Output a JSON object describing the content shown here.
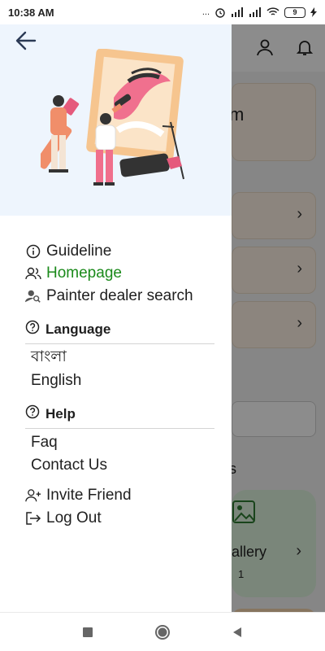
{
  "status_bar": {
    "time": "10:38 AM",
    "dots": "...",
    "battery": "9"
  },
  "background": {
    "title_fragment": "m",
    "section_fragment": "s",
    "gallery_label": "allery",
    "gallery_count": "1"
  },
  "drawer": {
    "menu": {
      "guideline": "Guideline",
      "homepage": "Homepage",
      "painter_dealer_search": "Painter dealer search"
    },
    "language": {
      "header": "Language",
      "options": [
        "বাংলা",
        "English"
      ]
    },
    "help": {
      "header": "Help",
      "items": [
        "Faq",
        "Contact Us"
      ]
    },
    "invite_friend": "Invite Friend",
    "log_out": "Log Out"
  },
  "colors": {
    "active_item": "#1b8a1b",
    "hero_bg": "#eef5fd",
    "scrim": "rgba(0,0,0,0.45)"
  }
}
